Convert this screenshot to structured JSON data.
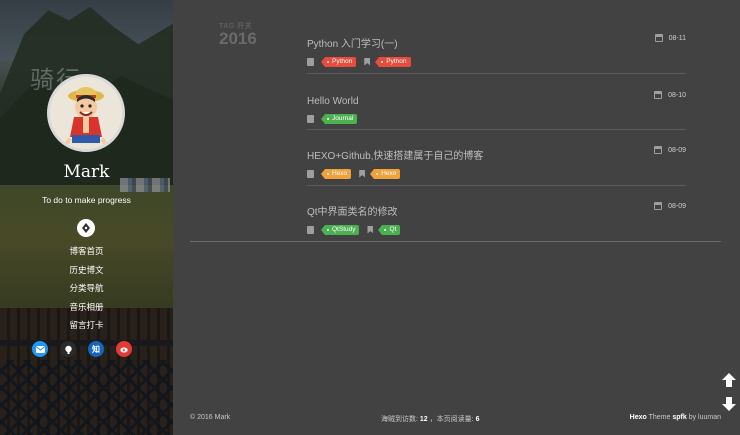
{
  "sidebar": {
    "background_art_text": "骑行",
    "author_name": "Mark",
    "motto": "To do to make progress",
    "nav": [
      {
        "label": "博客首页"
      },
      {
        "label": "历史博文"
      },
      {
        "label": "分类导航"
      },
      {
        "label": "音乐相册"
      },
      {
        "label": "留言打卡"
      }
    ],
    "social": [
      {
        "icon": "mail-icon",
        "color": "#2196f3"
      },
      {
        "icon": "github-icon",
        "color": "#2b2b2b"
      },
      {
        "icon": "zhihu-icon",
        "label": "知",
        "color": "#1565c0"
      },
      {
        "icon": "weibo-icon",
        "color": "#e53935"
      }
    ]
  },
  "archive": {
    "caption": "TAG 开关",
    "year": "2016",
    "posts": [
      {
        "title": "Python 入门学习(一)",
        "date": "08-11",
        "category": "Python",
        "tags": [
          "Python"
        ]
      },
      {
        "title": "Hello World",
        "date": "08-10",
        "category": "Journal",
        "tags": []
      },
      {
        "title": "HEXO+Github,快速搭建属于自己的博客",
        "date": "08-09",
        "category": "Hexo",
        "tags": [
          "Hexo"
        ]
      },
      {
        "title": "Qt中界面类名的修改",
        "date": "08-09",
        "category": "QtStudy",
        "tags": [
          "Qt"
        ]
      }
    ]
  },
  "footer": {
    "copyright": "© 2016 Mark",
    "visits_label": "海贼到访数:",
    "visits_value": "12",
    "views_label": "，本页阅读量:",
    "views_value": "6",
    "theme_brand": "Hexo",
    "theme_word": "Theme",
    "theme_name": "spfk",
    "theme_by": "by luuman"
  },
  "colors": {
    "background": "#424242",
    "tag_red": "#e74c3c",
    "tag_green": "#4caf50",
    "tag_orange": "#f0a33c"
  }
}
